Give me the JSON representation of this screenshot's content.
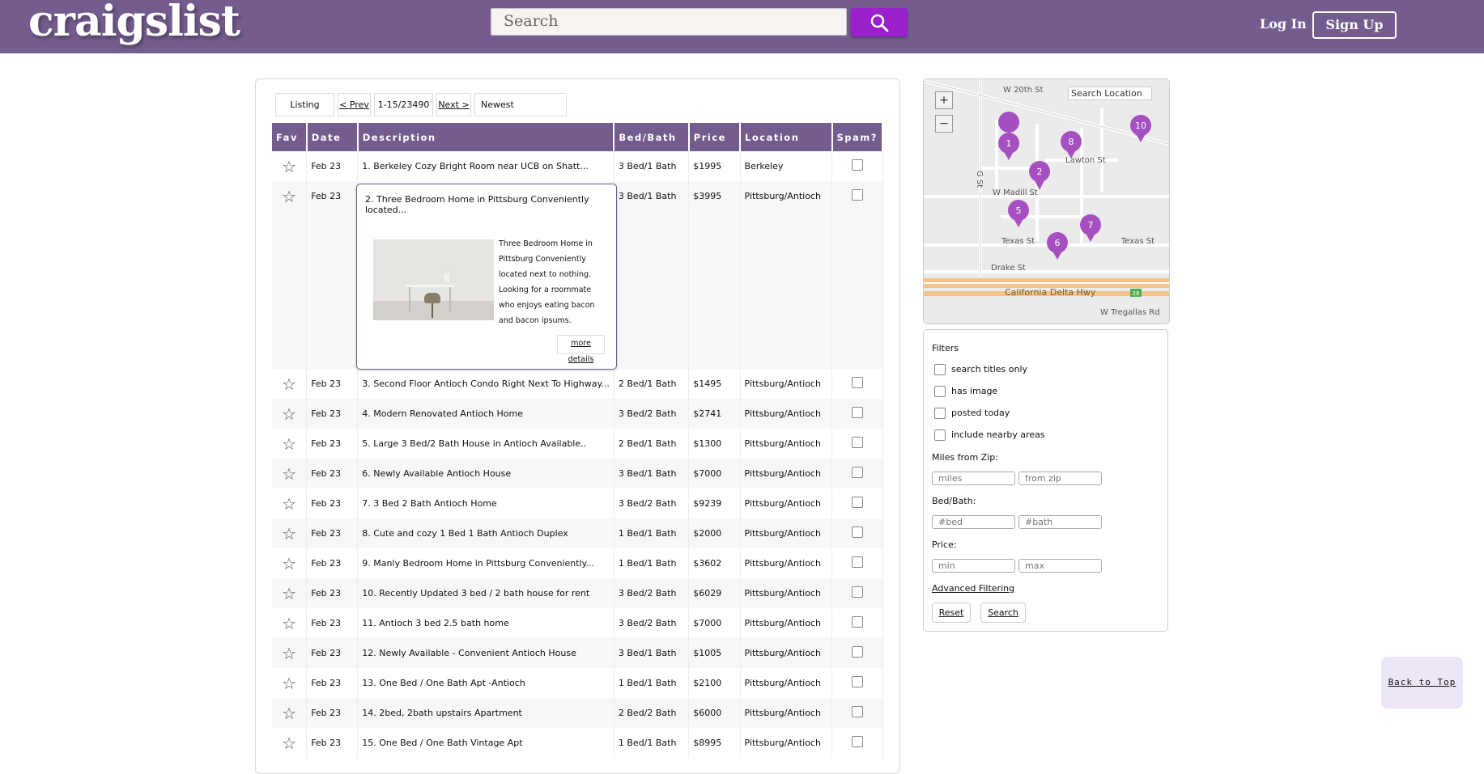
{
  "header": {
    "logo": "craigslist",
    "search_placeholder": "Search",
    "login_label": "Log In",
    "signup_label": "Sign Up"
  },
  "controls": {
    "listing_label": "Listing",
    "prev_label": "< Prev",
    "range": "1-15/23490",
    "next_label": "Next >",
    "sort": "Newest"
  },
  "table": {
    "columns": [
      "Fav",
      "Date",
      "Description",
      "Bed/Bath",
      "Price",
      "Location",
      "Spam?"
    ],
    "rows": [
      {
        "date": "Feb 23",
        "desc": "1. Berkeley Cozy Bright Room near UCB on Shatt...",
        "bedbath": "3 Bed/1 Bath",
        "price": "$1995",
        "location": "Berkeley"
      },
      {
        "date": "Feb 23",
        "desc": "2. Three Bedroom Home in Pittsburg Conveniently located...",
        "bedbath": "3 Bed/1 Bath",
        "price": "$3995",
        "location": "Pittsburg/Antioch"
      },
      {
        "date": "Feb 23",
        "desc": "3. Second Floor Antioch Condo Right Next To Highway...",
        "bedbath": "2 Bed/1 Bath",
        "price": "$1495",
        "location": "Pittsburg/Antioch"
      },
      {
        "date": "Feb 23",
        "desc": "4. Modern Renovated Antioch Home",
        "bedbath": "3 Bed/2 Bath",
        "price": "$2741",
        "location": "Pittsburg/Antioch"
      },
      {
        "date": "Feb 23",
        "desc": "5. Large 3 Bed/2 Bath House in Antioch Available..",
        "bedbath": "2 Bed/1 Bath",
        "price": "$1300",
        "location": "Pittsburg/Antioch"
      },
      {
        "date": "Feb 23",
        "desc": "6. Newly Available Antioch House",
        "bedbath": "3 Bed/1 Bath",
        "price": "$7000",
        "location": "Pittsburg/Antioch"
      },
      {
        "date": "Feb 23",
        "desc": "7. 3 Bed 2 Bath Antioch Home",
        "bedbath": "3 Bed/2 Bath",
        "price": "$9239",
        "location": "Pittsburg/Antioch"
      },
      {
        "date": "Feb 23",
        "desc": "8. Cute and cozy 1 Bed 1 Bath Antioch Duplex",
        "bedbath": "1 Bed/1 Bath",
        "price": "$2000",
        "location": "Pittsburg/Antioch"
      },
      {
        "date": "Feb 23",
        "desc": "9. Manly Bedroom Home in Pittsburg Conveniently...",
        "bedbath": "1 Bed/1 Bath",
        "price": "$3602",
        "location": "Pittsburg/Antioch"
      },
      {
        "date": "Feb 23",
        "desc": "10. Recently Updated 3 bed / 2 bath house for rent",
        "bedbath": "3 Bed/2 Bath",
        "price": "$6029",
        "location": "Pittsburg/Antioch"
      },
      {
        "date": "Feb 23",
        "desc": "11. Antioch 3 bed 2.5 bath home",
        "bedbath": "3 Bed/2 Bath",
        "price": "$7000",
        "location": "Pittsburg/Antioch"
      },
      {
        "date": "Feb 23",
        "desc": "12. Newly Available - Convenient Antioch House",
        "bedbath": "3 Bed/1 Bath",
        "price": "$1005",
        "location": "Pittsburg/Antioch"
      },
      {
        "date": "Feb 23",
        "desc": "13. One Bed / One Bath Apt -Antioch",
        "bedbath": "1 Bed/1 Bath",
        "price": "$2100",
        "location": "Pittsburg/Antioch"
      },
      {
        "date": "Feb 23",
        "desc": "14. 2bed, 2bath upstairs Apartment",
        "bedbath": "2 Bed/2 Bath",
        "price": "$6000",
        "location": "Pittsburg/Antioch"
      },
      {
        "date": "Feb 23",
        "desc": "15. One Bed / One Bath Vintage Apt",
        "bedbath": "1 Bed/1 Bath",
        "price": "$8995",
        "location": "Pittsburg/Antioch"
      }
    ]
  },
  "popup": {
    "title": "2. Three Bedroom Home in Pittsburg Conveniently located...",
    "description": "Three Bedroom Home in Pittsburg Conveniently located next to nothing. Looking for a roommate who enjoys eating bacon and bacon ipsums.",
    "more_label": "more details"
  },
  "map": {
    "search_placeholder": "Search Location",
    "zoom_in": "+",
    "zoom_out": "−",
    "streets": [
      "W 20th St",
      "Lawton St",
      "G St",
      "W Madill St",
      "Texas St",
      "Texas St",
      "Drake St",
      "California Delta Hwy",
      "W Tregallas Rd"
    ],
    "highway_shield": "28",
    "pins": [
      "1",
      "2",
      "8",
      "10",
      "5",
      "7",
      "6"
    ]
  },
  "filters": {
    "title": "Filters",
    "options": [
      "search titles only",
      "has image",
      "posted today",
      "include nearby areas"
    ],
    "miles_label": "Miles from Zip:",
    "miles_placeholder": "miles",
    "zip_placeholder": "from zip",
    "bedbath_label": "Bed/Bath:",
    "bed_placeholder": "#bed",
    "bath_placeholder": "#bath",
    "price_label": "Price:",
    "min_placeholder": "min",
    "max_placeholder": "max",
    "advanced_label": "Advanced Filtering",
    "reset_label": "Reset",
    "search_label": "Search"
  },
  "back_to_top": "Back to Top",
  "colors": {
    "header": "#745c8e",
    "search_button": "#9b1fcc",
    "map_pin": "#a64fc1"
  }
}
